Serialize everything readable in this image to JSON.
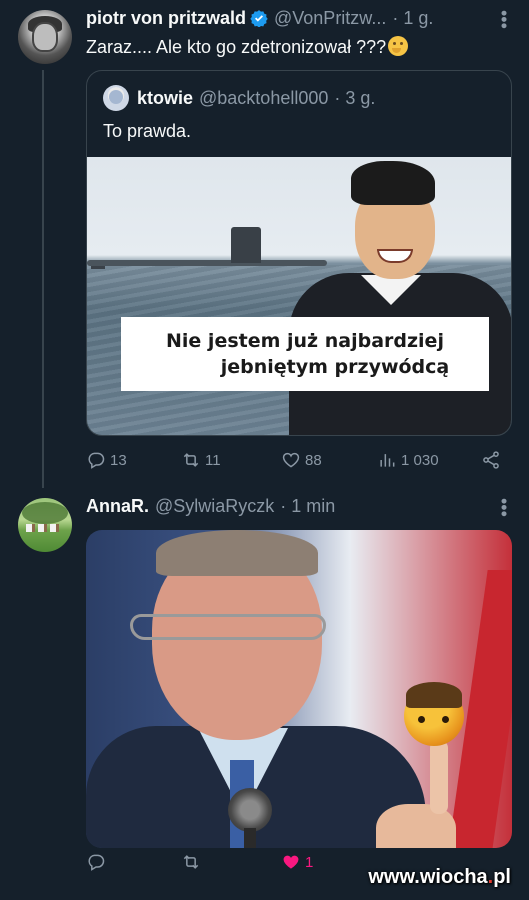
{
  "tweet1": {
    "author_name": "piotr von pritzwald",
    "handle": "@VonPritzw...",
    "time": "· 1 g.",
    "text": "Zaraz.... Ale kto go zdetronizował ???",
    "emoji": "thinking-face-emoji",
    "quote": {
      "author_name": "ktowie",
      "handle": "@backtohell000",
      "time": "· 3 g.",
      "text": "To prawda.",
      "image_caption_line1": "Nie jestem już najbardziej",
      "image_caption_line2": "jebniętym przywódcą"
    },
    "actions": {
      "replies": "13",
      "retweets": "11",
      "likes": "88",
      "views": "1 030"
    }
  },
  "tweet2": {
    "author_name": "AnnaR.",
    "handle": "@SylwiaRyczk",
    "time": "· 1 min",
    "actions": {
      "likes": "1"
    },
    "watermark_prefix": "www.",
    "watermark_brand": "wiocha",
    "watermark_dot": ".",
    "watermark_suffix": "pl"
  },
  "colors": {
    "background": "#15202b",
    "muted": "#8b98a5",
    "verified": "#1d9bf0",
    "like_active": "#f91880"
  }
}
